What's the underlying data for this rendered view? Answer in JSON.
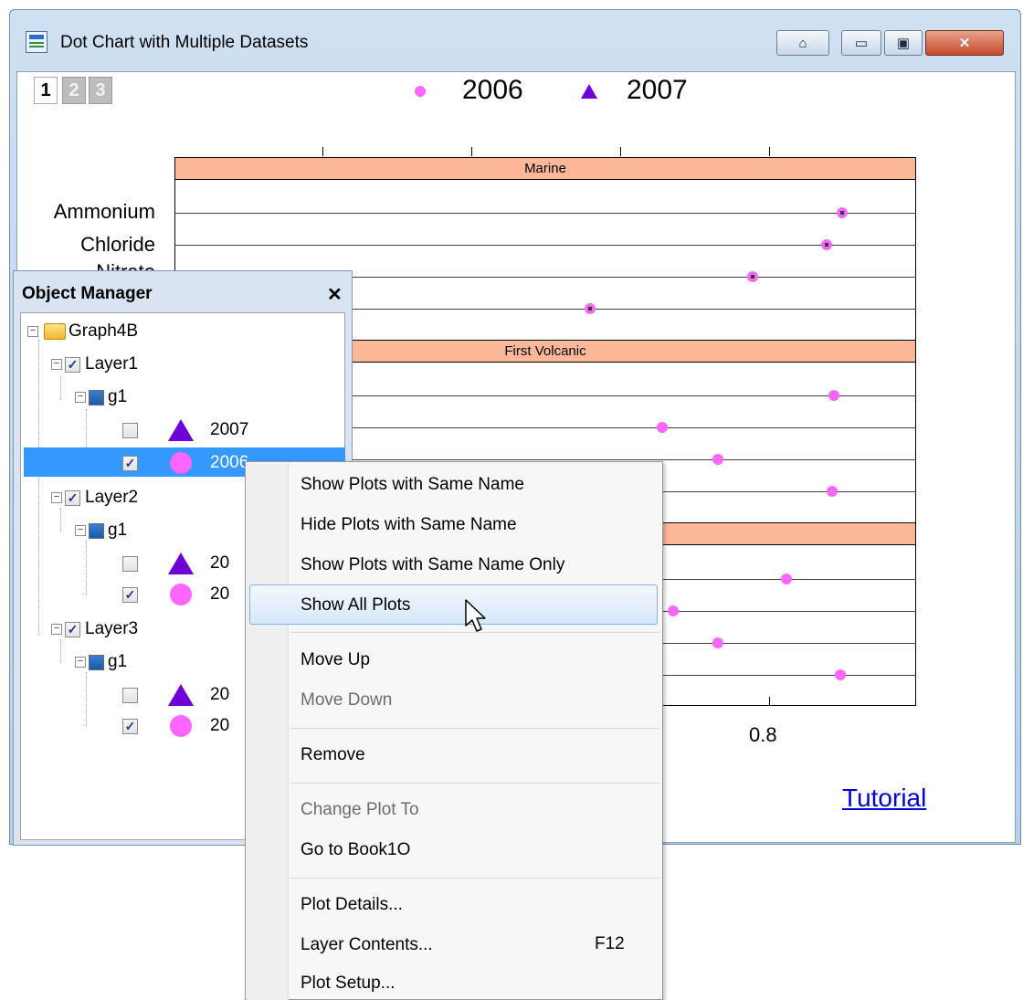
{
  "window": {
    "title": "Dot Chart with Multiple Datasets",
    "buttons": {
      "home": "⌂",
      "minimize": "▭",
      "restore": "▣",
      "close": "✕"
    }
  },
  "layer_tabs": [
    "1",
    "2",
    "3"
  ],
  "legend": [
    {
      "label": "2006",
      "marker": "circle",
      "color": "#ff66ff"
    },
    {
      "label": "2007",
      "marker": "triangle",
      "color": "#7000d8"
    }
  ],
  "graph": {
    "panels": [
      "Marine",
      "First Volcanic",
      ""
    ],
    "categories": [
      "Ammonium",
      "Chloride",
      "Nitrate"
    ],
    "x_tick_label": "0.8",
    "link_text": "Tutorial"
  },
  "object_manager": {
    "title": "Object Manager",
    "close": "✕",
    "tree": {
      "root": "Graph4B",
      "layers": [
        {
          "name": "Layer1",
          "group": "g1",
          "plots": [
            {
              "label": "2007",
              "checked": false,
              "marker": "triangle"
            },
            {
              "label": "2006",
              "checked": true,
              "marker": "circle"
            }
          ]
        },
        {
          "name": "Layer2",
          "group": "g1",
          "plots": [
            {
              "label": "20",
              "checked": false,
              "marker": "triangle"
            },
            {
              "label": "20",
              "checked": true,
              "marker": "circle"
            }
          ]
        },
        {
          "name": "Layer3",
          "group": "g1",
          "plots": [
            {
              "label": "20",
              "checked": false,
              "marker": "triangle"
            },
            {
              "label": "20",
              "checked": true,
              "marker": "circle"
            }
          ]
        }
      ]
    }
  },
  "context_menu": {
    "items": [
      "Show Plots with Same Name",
      "Hide Plots with Same Name",
      "Show Plots with Same Name Only",
      "Show All Plots",
      "Move Up",
      "Move Down",
      "Remove",
      "Change Plot To",
      "Go to Book1O",
      "Plot Details...",
      "Layer Contents...",
      "Plot Setup..."
    ],
    "shortcut_layer_contents": "F12"
  }
}
